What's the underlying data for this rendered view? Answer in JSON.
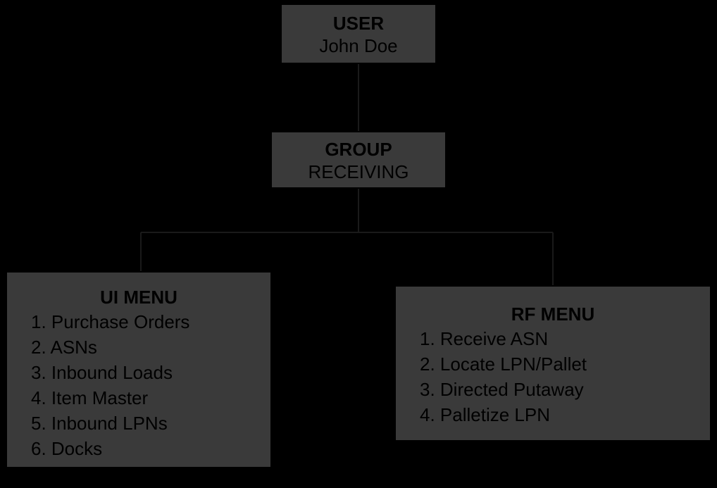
{
  "user_box": {
    "title": "USER",
    "value": "John Doe"
  },
  "group_box": {
    "title": "GROUP",
    "value": "RECEIVING"
  },
  "ui_menu": {
    "title": "UI MENU",
    "items": [
      "Purchase Orders",
      "ASNs",
      "Inbound Loads",
      "Item Master",
      "Inbound LPNs",
      "Docks"
    ]
  },
  "rf_menu": {
    "title": "RF MENU",
    "items": [
      "Receive ASN",
      "Locate LPN/Pallet",
      "Directed Putaway",
      "Palletize LPN"
    ]
  }
}
